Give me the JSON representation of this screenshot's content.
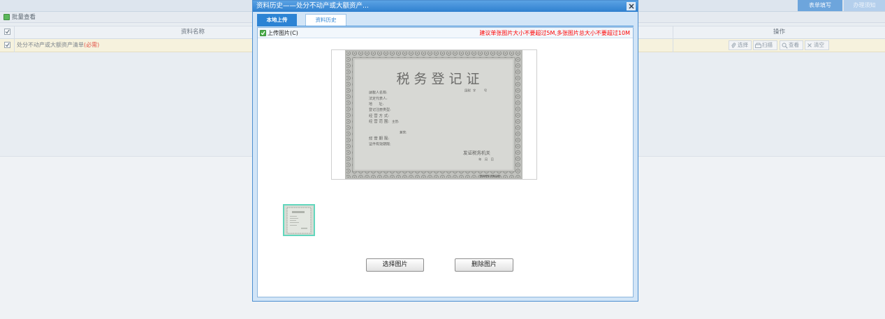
{
  "header": {
    "tabs": [
      {
        "label": "表单填写",
        "active": true
      },
      {
        "label": "办理须知",
        "active": false
      }
    ]
  },
  "toolbar": {
    "batch_view_label": "批量查看",
    "batch_view_icon": "batch-view-icon"
  },
  "table": {
    "columns": {
      "name": "资料名称",
      "actions": "操作"
    },
    "rows": [
      {
        "checked": true,
        "name": "处分不动产或大额资产清单",
        "required": "(必需)",
        "actions": [
          {
            "label": "选择",
            "icon": "paperclip-icon"
          },
          {
            "label": "扫描",
            "icon": "scanner-icon"
          },
          {
            "label": "查看",
            "icon": "magnifier-icon"
          },
          {
            "label": "清空",
            "icon": "close-icon"
          }
        ]
      }
    ]
  },
  "dialog": {
    "title": "资料历史——处分不动产或大额资产...",
    "close_icon": "close-icon",
    "tabs": [
      {
        "label": "本地上传",
        "active": true
      },
      {
        "label": "资料历史",
        "active": false
      }
    ],
    "upload": {
      "label": "上传图片(C)",
      "checked": true,
      "size_hint": "建议单张图片大小不要超过5M,多张图片总大小不要超过10M"
    },
    "preview": {
      "certificate": {
        "title": "税 务 登 记 证",
        "number_line": "国税  字        号",
        "fields": [
          "纳税人名称:",
          "法定代表人:",
          "地      址:",
          "登记注册类型:",
          "经 营 方 式:",
          "经 营 范 围:",
          "主营:",
          "兼营:",
          "经 营 期 限:",
          "证件有效期限:"
        ],
        "issuer": "发证税务机关",
        "date": "年   月   日",
        "footer": "国家税务总局监制"
      }
    },
    "thumbnails": [
      {
        "selected": true
      }
    ],
    "buttons": {
      "select": "选择图片",
      "delete": "删除图片"
    }
  },
  "colors": {
    "accent": "#2c83d4",
    "title_bar": "#3f8fd8",
    "required": "#e2574c",
    "hint": "#ff0000",
    "thumbnail_selected": "#63d7be"
  }
}
